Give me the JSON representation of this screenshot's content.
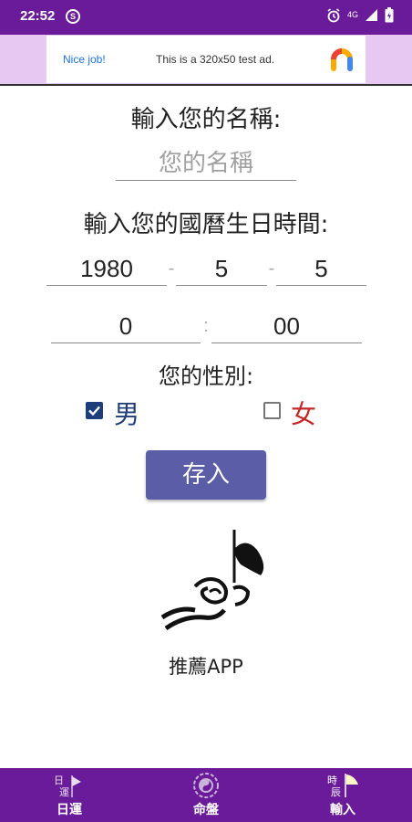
{
  "status_bar": {
    "time": "22:52",
    "network": "4G",
    "icons": [
      "sync-icon",
      "alarm-icon",
      "signal-icon",
      "battery-icon"
    ]
  },
  "ad": {
    "nice_job": "Nice job!",
    "text": "This is a 320x50 test ad."
  },
  "form": {
    "name_label": "輸入您的名稱:",
    "name_placeholder": "您的名稱",
    "birth_label": "輸入您的國曆生日時間:",
    "year": "1980",
    "month": "5",
    "day": "5",
    "hour": "0",
    "minute": "00",
    "date_separator": "-",
    "time_separator": ":",
    "gender_label": "您的性別:",
    "male_label": "男",
    "female_label": "女",
    "male_checked": true,
    "female_checked": false,
    "save_label": "存入"
  },
  "recommend": {
    "label": "推薦APP"
  },
  "bottom_nav": {
    "items": [
      {
        "label": "日運",
        "icon": "daily-fortune-icon"
      },
      {
        "label": "命盤",
        "icon": "destiny-chart-icon"
      },
      {
        "label": "輸入",
        "icon": "input-time-icon"
      }
    ]
  },
  "colors": {
    "primary": "#6a1b9a",
    "ad_background": "#e6c8f2",
    "button": "#5b5ea6",
    "male": "#1e3d7b",
    "female": "#c62828"
  }
}
